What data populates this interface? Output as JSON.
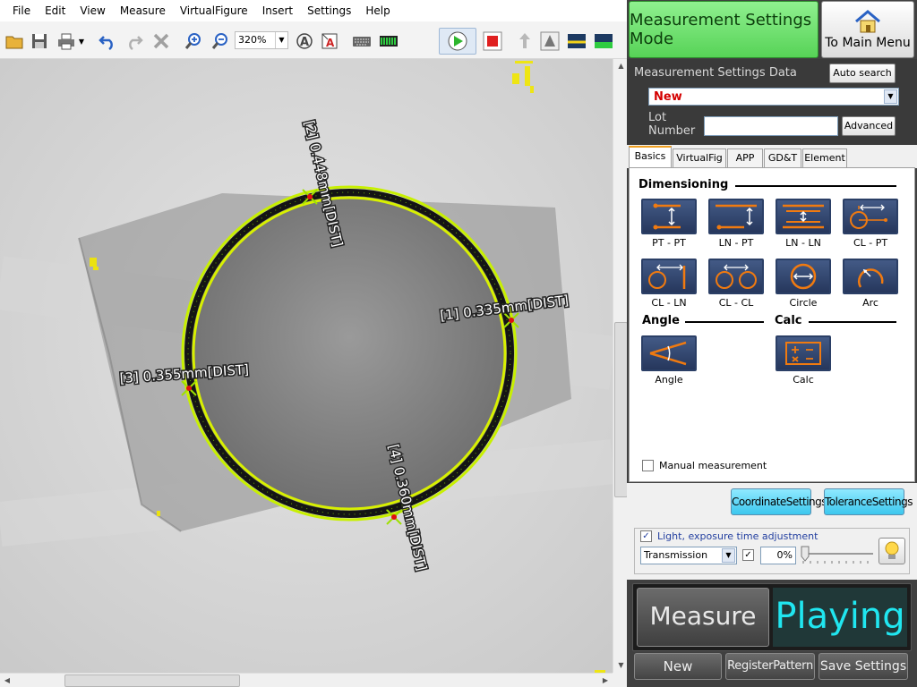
{
  "menu": [
    "File",
    "Edit",
    "View",
    "Measure",
    "VirtualFigure",
    "Insert",
    "Settings",
    "Help"
  ],
  "toolbar": {
    "zoom": "320%"
  },
  "viewer": {
    "annotations": [
      {
        "label": "[1] 0.335mm[DIST]"
      },
      {
        "label": "[2] 0.448mm[DIST]"
      },
      {
        "label": "[3] 0.355mm[DIST]"
      },
      {
        "label": "[4] 0.360mm[DIST]"
      }
    ]
  },
  "header": {
    "mode_label": "Measurement Settings Mode",
    "main_menu_label": "To Main Menu"
  },
  "settings_data": {
    "title": "Measurement Settings Data",
    "auto_search": "Auto search",
    "selected": "New",
    "lot_label_1": "Lot",
    "lot_label_2": "Number",
    "lot_value": "",
    "advanced": "Advanced"
  },
  "tabs": [
    "Basics",
    "VirtualFig",
    "APP",
    "GD&T",
    "Element"
  ],
  "sections": {
    "dimensioning": "Dimensioning",
    "angle": "Angle",
    "calc": "Calc"
  },
  "tools": {
    "pt_pt": "PT - PT",
    "ln_pt": "LN - PT",
    "ln_ln": "LN - LN",
    "cl_pt": "CL - PT",
    "cl_ln": "CL - LN",
    "cl_cl": "CL - CL",
    "circle": "Circle",
    "arc": "Arc",
    "angle": "Angle",
    "calc": "Calc"
  },
  "manual_measurement": "Manual measurement",
  "buttons": {
    "coordinate": "CoordinateSettings",
    "tolerance": "ToleranceSettings"
  },
  "light": {
    "label": "Light, exposure time adjustment",
    "mode": "Transmission",
    "value": "0%"
  },
  "measure": {
    "button": "Measure",
    "status": "Playing"
  },
  "bottom": {
    "new": "New",
    "register": "RegisterPattern",
    "save": "Save Settings"
  },
  "colors": {
    "accent_green": "#57d357",
    "status_cyan": "#20e6f0",
    "tool_orange": "#f07a10",
    "selected_red": "#d40000"
  }
}
